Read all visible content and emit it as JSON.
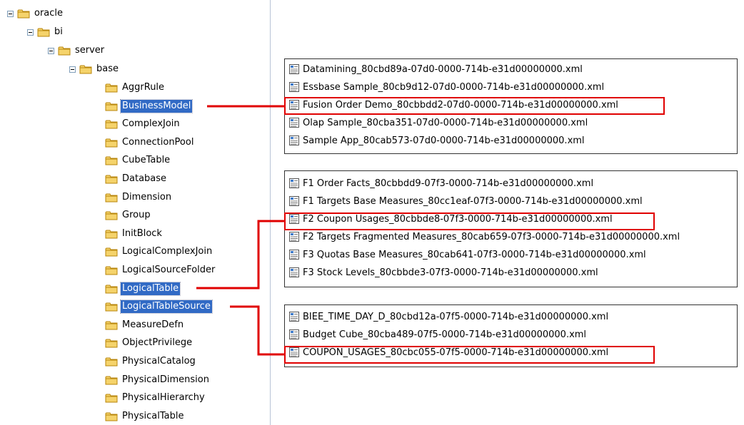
{
  "tree": {
    "root": "oracle",
    "level1": "bi",
    "level2": "server",
    "level3": "base",
    "items": [
      "AggrRule",
      "BusinessModel",
      "ComplexJoin",
      "ConnectionPool",
      "CubeTable",
      "Database",
      "Dimension",
      "Group",
      "InitBlock",
      "LogicalComplexJoin",
      "LogicalSourceFolder",
      "LogicalTable",
      "LogicalTableSource",
      "MeasureDefn",
      "ObjectPrivilege",
      "PhysicalCatalog",
      "PhysicalDimension",
      "PhysicalHierarchy",
      "PhysicalTable"
    ],
    "selected": [
      "BusinessModel",
      "LogicalTable",
      "LogicalTableSource"
    ]
  },
  "groups": [
    {
      "files": [
        "Datamining_80cbd89a-07d0-0000-714b-e31d00000000.xml",
        "Essbase Sample_80cb9d12-07d0-0000-714b-e31d00000000.xml",
        "Fusion Order Demo_80cbbdd2-07d0-0000-714b-e31d00000000.xml",
        "Olap Sample_80cba351-07d0-0000-714b-e31d00000000.xml",
        "Sample App_80cab573-07d0-0000-714b-e31d00000000.xml"
      ],
      "highlighted_index": 2
    },
    {
      "files": [
        "F1 Order Facts_80cbbdd9-07f3-0000-714b-e31d00000000.xml",
        "F1 Targets Base Measures_80cc1eaf-07f3-0000-714b-e31d00000000.xml",
        "F2 Coupon Usages_80cbbde8-07f3-0000-714b-e31d00000000.xml",
        "F2 Targets Fragmented Measures_80cab659-07f3-0000-714b-e31d00000000.xml",
        "F3 Quotas Base Measures_80cab641-07f3-0000-714b-e31d00000000.xml",
        "F3 Stock Levels_80cbbde3-07f3-0000-714b-e31d00000000.xml"
      ],
      "highlighted_index": 2
    },
    {
      "files": [
        "BIEE_TIME_DAY_D_80cbd12a-07f5-0000-714b-e31d00000000.xml",
        "Budget Cube_80cba489-07f5-0000-714b-e31d00000000.xml",
        "COUPON_USAGES_80cbc055-07f5-0000-714b-e31d00000000.xml"
      ],
      "highlighted_index": 2
    }
  ],
  "colors": {
    "selection": "#316ac5",
    "highlight": "#e00000",
    "folder": "#f5d36b"
  },
  "icons": {
    "folder": "folder-icon",
    "file": "xml-file-icon",
    "expander": "collapse-icon"
  }
}
